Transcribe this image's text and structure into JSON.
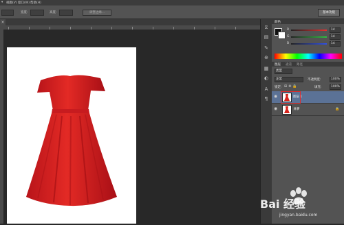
{
  "menu": {
    "items": [
      "视图(V)",
      "窗口(W)",
      "帮助(H)"
    ]
  },
  "options_bar": {
    "label_1": "宽度:",
    "label_2": "高度:",
    "button": "调整边缘...",
    "workspace": "基本功能"
  },
  "panels": {
    "color": {
      "tab": "颜色",
      "rows": [
        {
          "label": "R",
          "value": "14",
          "color": "#e53030"
        },
        {
          "label": "G",
          "value": "14",
          "color": "#30c040"
        },
        {
          "label": "B",
          "value": "14",
          "color": "#3050e5"
        }
      ]
    },
    "layers": {
      "tabs": [
        "图层",
        "通道",
        "路径"
      ],
      "filter": "类型",
      "blend": "正常",
      "opacity_label": "不透明度:",
      "opacity": "100%",
      "lock_label": "锁定:",
      "fill_label": "填充:",
      "fill": "100%",
      "items": [
        {
          "name": "图层 1",
          "selected": true
        },
        {
          "name": "背景",
          "selected": false
        }
      ]
    }
  },
  "watermark": {
    "brand": "Bai 经验",
    "url": "jingyan.baidu.com"
  },
  "colors": {
    "accent": "#d7251e",
    "selection": "#5b7296",
    "highlight_box": "#e02a2a"
  }
}
